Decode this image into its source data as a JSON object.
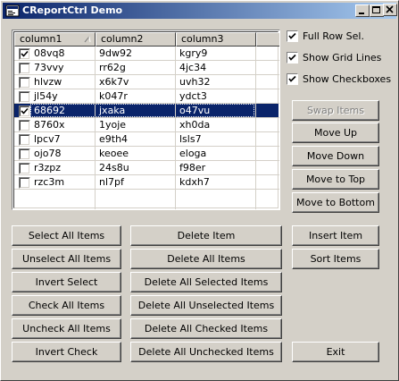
{
  "window": {
    "title": "CReportCtrl Demo",
    "controls": [
      "minimize",
      "maximize",
      "close"
    ]
  },
  "list": {
    "columns": [
      "column1",
      "column2",
      "column3"
    ],
    "sort_column": "column1",
    "rows": [
      {
        "checked": true,
        "selected": false,
        "cells": [
          "08vq8",
          "9dw92",
          "kgry9"
        ]
      },
      {
        "checked": false,
        "selected": false,
        "cells": [
          "73vvy",
          "rr62g",
          "4jc34"
        ]
      },
      {
        "checked": false,
        "selected": false,
        "cells": [
          "hlvzw",
          "x6k7v",
          "uvh32"
        ]
      },
      {
        "checked": false,
        "selected": false,
        "cells": [
          "jl54y",
          "k047r",
          "ydct3"
        ]
      },
      {
        "checked": true,
        "selected": true,
        "cells": [
          "68692",
          "jxaka",
          "o47vu"
        ]
      },
      {
        "checked": false,
        "selected": false,
        "cells": [
          "8760x",
          "1yoje",
          "xh0da"
        ]
      },
      {
        "checked": false,
        "selected": false,
        "cells": [
          "lpcv7",
          "e9th4",
          "lsls7"
        ]
      },
      {
        "checked": false,
        "selected": false,
        "cells": [
          "ojo78",
          "keoee",
          "eloga"
        ]
      },
      {
        "checked": false,
        "selected": false,
        "cells": [
          "r3zpz",
          "24s8u",
          "f98er"
        ]
      },
      {
        "checked": false,
        "selected": false,
        "cells": [
          "rzc3m",
          "nl7pf",
          "kdxh7"
        ]
      }
    ]
  },
  "options": {
    "full_row_sel": {
      "label": "Full Row Sel.",
      "checked": true
    },
    "show_grid_lines": {
      "label": "Show Grid Lines",
      "checked": true
    },
    "show_checkboxes": {
      "label": "Show Checkboxes",
      "checked": true
    }
  },
  "move_buttons": {
    "swap": "Swap Items",
    "up": "Move Up",
    "down": "Move Down",
    "top": "Move to Top",
    "bottom": "Move to Bottom"
  },
  "left_buttons": {
    "select_all": "Select All Items",
    "unselect_all": "Unselect All Items",
    "invert_select": "Invert Select",
    "check_all": "Check All Items",
    "uncheck_all": "Uncheck All Items",
    "invert_check": "Invert Check"
  },
  "middle_buttons": {
    "delete_item": "Delete Item",
    "delete_all": "Delete All Items",
    "delete_all_selected": "Delete All Selected Items",
    "delete_all_unselected": "Delete All Unselected Items",
    "delete_all_checked": "Delete All Checked Items",
    "delete_all_unchecked": "Delete All Unchecked Items"
  },
  "right_buttons": {
    "insert_item": "Insert Item",
    "sort_items": "Sort Items",
    "exit": "Exit"
  },
  "colors": {
    "face": "#d4d0c8",
    "title_start": "#0a246a",
    "title_end": "#a6caf0",
    "selection": "#0a246a"
  }
}
